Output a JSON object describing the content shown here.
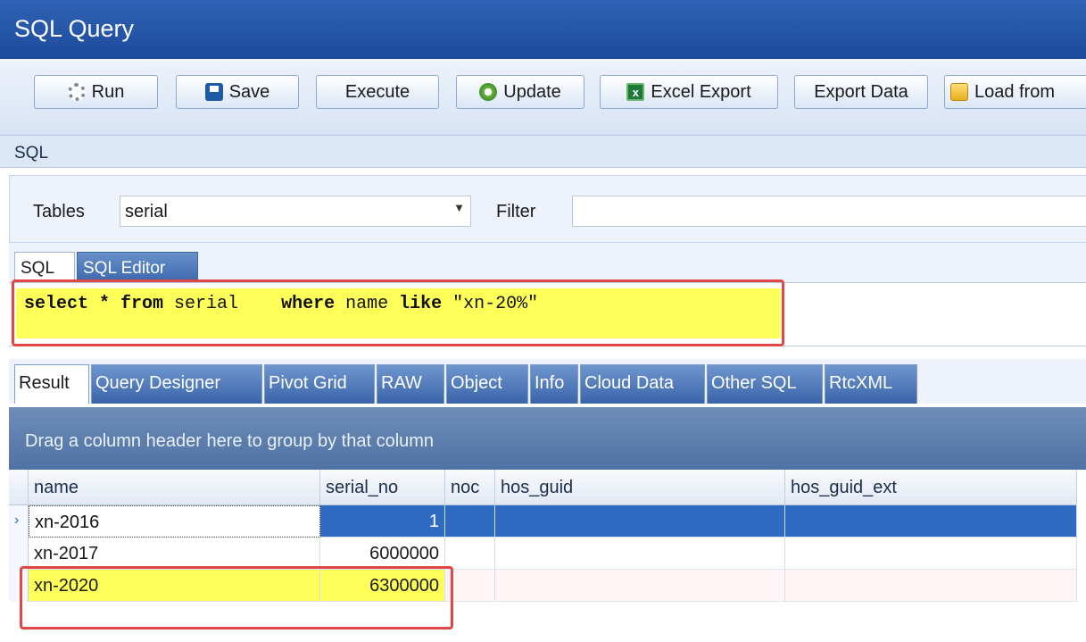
{
  "window": {
    "title": "SQL Query"
  },
  "toolbar": {
    "run": "Run",
    "save": "Save",
    "execute": "Execute",
    "update": "Update",
    "excel_export": "Excel Export",
    "export_data": "Export Data",
    "load_from": "Load from"
  },
  "sql_section": {
    "label": "SQL"
  },
  "filters": {
    "tables_label": "Tables",
    "tables_value": "serial",
    "filter_label": "Filter",
    "filter_value": ""
  },
  "sql_tabs": [
    "SQL",
    "SQL Editor"
  ],
  "editor": {
    "kw_select_from": "select * from",
    "table": "serial",
    "kw_where": "where",
    "column": "name",
    "kw_like": "like",
    "pattern": "\"xn-20%\""
  },
  "result_tabs": [
    "Result",
    "Query Designer",
    "Pivot Grid",
    "RAW",
    "Object",
    "Info",
    "Cloud Data",
    "Other SQL",
    "RtcXML"
  ],
  "group_hint": "Drag a column header here to group by that column",
  "grid": {
    "columns": [
      "name",
      "serial_no",
      "noc",
      "hos_guid",
      "hos_guid_ext"
    ],
    "rows": [
      {
        "name": "xn-2016",
        "serial_no": "1",
        "noc": "",
        "hos_guid": "",
        "hos_guid_ext": ""
      },
      {
        "name": "xn-2017",
        "serial_no": "6000000",
        "noc": "",
        "hos_guid": "",
        "hos_guid_ext": ""
      },
      {
        "name": "xn-2020",
        "serial_no": "6300000",
        "noc": "",
        "hos_guid": "",
        "hos_guid_ext": ""
      }
    ],
    "current_row_glyph": "›"
  },
  "colors": {
    "title_bar": "#2458a8",
    "highlight": "#ffff5a",
    "annotation": "#e04848",
    "selection": "#2f6bc2"
  }
}
